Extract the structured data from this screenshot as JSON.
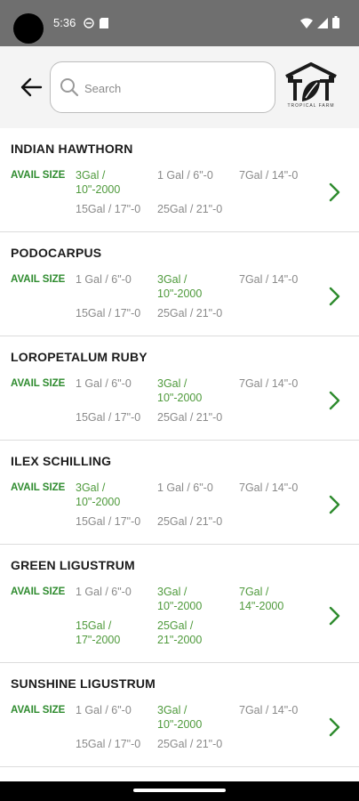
{
  "status": {
    "time": "5:36"
  },
  "search": {
    "placeholder": "Search",
    "value": ""
  },
  "logo": {
    "tagline": "TROPICAL FARM"
  },
  "plants": [
    {
      "name": "INDIAN HAWTHORN",
      "avail_label": "AVAIL SIZE",
      "sizes": [
        {
          "label": "3Gal / 10\"-2000",
          "lines": [
            "3Gal /",
            "10\"-2000"
          ],
          "available": true
        },
        {
          "label": "1 Gal / 6\"-0",
          "lines": [
            "1 Gal / 6\"-0"
          ],
          "available": false
        },
        {
          "label": "7Gal / 14\"-0",
          "lines": [
            "7Gal / 14\"-0"
          ],
          "available": false
        },
        {
          "label": "15Gal / 17\"-0",
          "lines": [
            "15Gal / 17\"-0"
          ],
          "available": false
        },
        {
          "label": "25Gal / 21\"-0",
          "lines": [
            "25Gal / 21\"-0"
          ],
          "available": false
        }
      ]
    },
    {
      "name": "PODOCARPUS",
      "avail_label": "AVAIL SIZE",
      "sizes": [
        {
          "label": "1 Gal / 6\"-0",
          "lines": [
            "1 Gal / 6\"-0"
          ],
          "available": false
        },
        {
          "label": "3Gal / 10\"-2000",
          "lines": [
            "3Gal /",
            "10\"-2000"
          ],
          "available": true
        },
        {
          "label": "7Gal / 14\"-0",
          "lines": [
            "7Gal / 14\"-0"
          ],
          "available": false
        },
        {
          "label": "15Gal / 17\"-0",
          "lines": [
            "15Gal / 17\"-0"
          ],
          "available": false
        },
        {
          "label": "25Gal / 21\"-0",
          "lines": [
            "25Gal / 21\"-0"
          ],
          "available": false
        }
      ]
    },
    {
      "name": "LOROPETALUM RUBY",
      "avail_label": "AVAIL SIZE",
      "sizes": [
        {
          "label": "1 Gal / 6\"-0",
          "lines": [
            "1 Gal / 6\"-0"
          ],
          "available": false
        },
        {
          "label": "3Gal / 10\"-2000",
          "lines": [
            "3Gal /",
            "10\"-2000"
          ],
          "available": true
        },
        {
          "label": "7Gal / 14\"-0",
          "lines": [
            "7Gal / 14\"-0"
          ],
          "available": false
        },
        {
          "label": "15Gal / 17\"-0",
          "lines": [
            "15Gal / 17\"-0"
          ],
          "available": false
        },
        {
          "label": "25Gal / 21\"-0",
          "lines": [
            "25Gal / 21\"-0"
          ],
          "available": false
        }
      ]
    },
    {
      "name": "ILEX SCHILLING",
      "avail_label": "AVAIL SIZE",
      "sizes": [
        {
          "label": "3Gal / 10\"-2000",
          "lines": [
            "3Gal /",
            "10\"-2000"
          ],
          "available": true
        },
        {
          "label": "1 Gal / 6\"-0",
          "lines": [
            "1 Gal / 6\"-0"
          ],
          "available": false
        },
        {
          "label": "7Gal / 14\"-0",
          "lines": [
            "7Gal / 14\"-0"
          ],
          "available": false
        },
        {
          "label": "15Gal / 17\"-0",
          "lines": [
            "15Gal / 17\"-0"
          ],
          "available": false
        },
        {
          "label": "25Gal / 21\"-0",
          "lines": [
            "25Gal / 21\"-0"
          ],
          "available": false
        }
      ]
    },
    {
      "name": "GREEN LIGUSTRUM",
      "avail_label": "AVAIL SIZE",
      "sizes": [
        {
          "label": "1 Gal / 6\"-0",
          "lines": [
            "1 Gal / 6\"-0"
          ],
          "available": false
        },
        {
          "label": "3Gal / 10\"-2000",
          "lines": [
            "3Gal /",
            "10\"-2000"
          ],
          "available": true
        },
        {
          "label": "7Gal / 14\"-2000",
          "lines": [
            "7Gal /",
            "14\"-2000"
          ],
          "available": true
        },
        {
          "label": "15Gal / 17\"-2000",
          "lines": [
            "15Gal /",
            "17\"-2000"
          ],
          "available": true
        },
        {
          "label": "25Gal / 21\"-2000",
          "lines": [
            "25Gal /",
            "21\"-2000"
          ],
          "available": true
        }
      ]
    },
    {
      "name": "SUNSHINE LIGUSTRUM",
      "avail_label": "AVAIL SIZE",
      "sizes": [
        {
          "label": "1 Gal / 6\"-0",
          "lines": [
            "1 Gal / 6\"-0"
          ],
          "available": false
        },
        {
          "label": "3Gal / 10\"-2000",
          "lines": [
            "3Gal /",
            "10\"-2000"
          ],
          "available": true
        },
        {
          "label": "7Gal / 14\"-0",
          "lines": [
            "7Gal / 14\"-0"
          ],
          "available": false
        },
        {
          "label": "15Gal / 17\"-0",
          "lines": [
            "15Gal / 17\"-0"
          ],
          "available": false
        },
        {
          "label": "25Gal / 21\"-0",
          "lines": [
            "25Gal / 21\"-0"
          ],
          "available": false
        }
      ]
    }
  ],
  "colors": {
    "accent_green": "#2e8b2e",
    "available_green": "#4f9a3c",
    "unavailable_gray": "#8a8a8a",
    "header_bg": "#f4f4f4",
    "status_bar_bg": "#6f6f6f"
  },
  "icons": {
    "back": "arrow-left-icon",
    "search": "search-icon",
    "row_action": "chevron-right-icon",
    "status": [
      "do-not-disturb-icon",
      "sd-card-icon",
      "wifi-icon",
      "signal-icon",
      "battery-icon"
    ]
  }
}
